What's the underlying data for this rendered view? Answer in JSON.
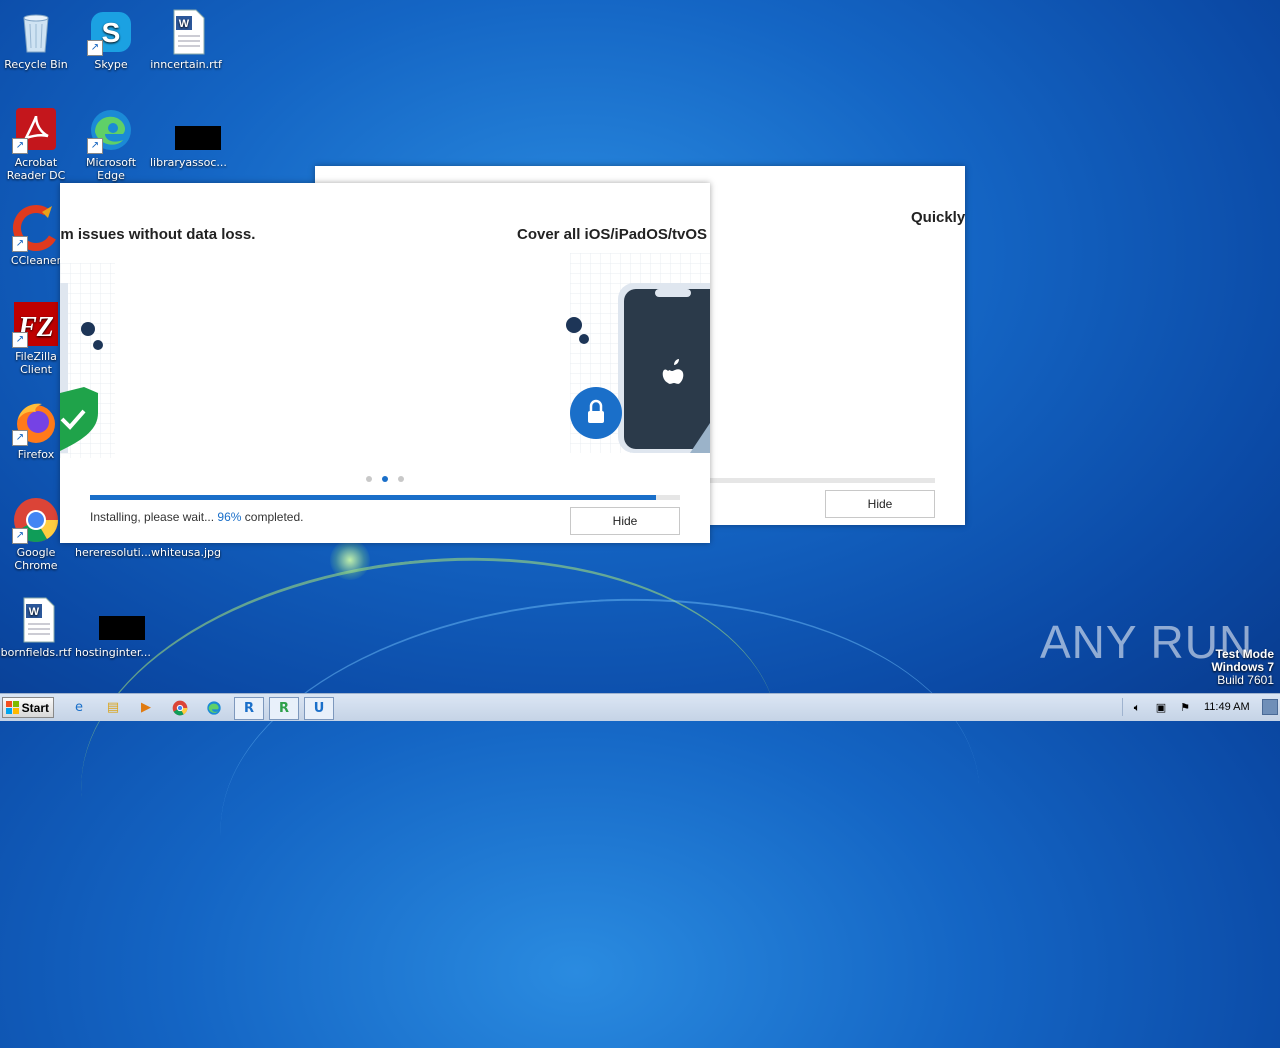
{
  "desktop": {
    "icons": [
      {
        "label": "Recycle Bin"
      },
      {
        "label": "Skype"
      },
      {
        "label": "inncertain.rtf"
      },
      {
        "label": "Acrobat Reader DC"
      },
      {
        "label": "Microsoft Edge"
      },
      {
        "label": "libraryassoc..."
      },
      {
        "label": "CCleaner"
      },
      {
        "label": "FileZilla Client"
      },
      {
        "label": "Firefox"
      },
      {
        "label": "Google Chrome"
      },
      {
        "label": "hereresoluti..."
      },
      {
        "label": "whiteusa.jpg"
      },
      {
        "label": "bornfields.rtf"
      },
      {
        "label": "hostinginter..."
      }
    ]
  },
  "installer_back": {
    "headline": "Quickly",
    "hide_label": "Hide"
  },
  "installer_front": {
    "headline_left": "em issues without data loss.",
    "headline_right": "Cover all iOS/iPadOS/tvOS",
    "status_prefix": "Installing, please wait... ",
    "status_pct": "96%",
    "status_suffix": " completed.",
    "progress": 0.96,
    "hide_label": "Hide",
    "carousel_active": 1,
    "carousel_count": 3
  },
  "watermark": {
    "testmode": "Test Mode",
    "os": "Windows 7",
    "build": "Build 7601",
    "brand": "ANY RUN"
  },
  "taskbar": {
    "start_label": "Start",
    "clock": "11:49 AM"
  },
  "colors": {
    "accent": "#1a6fc9"
  }
}
